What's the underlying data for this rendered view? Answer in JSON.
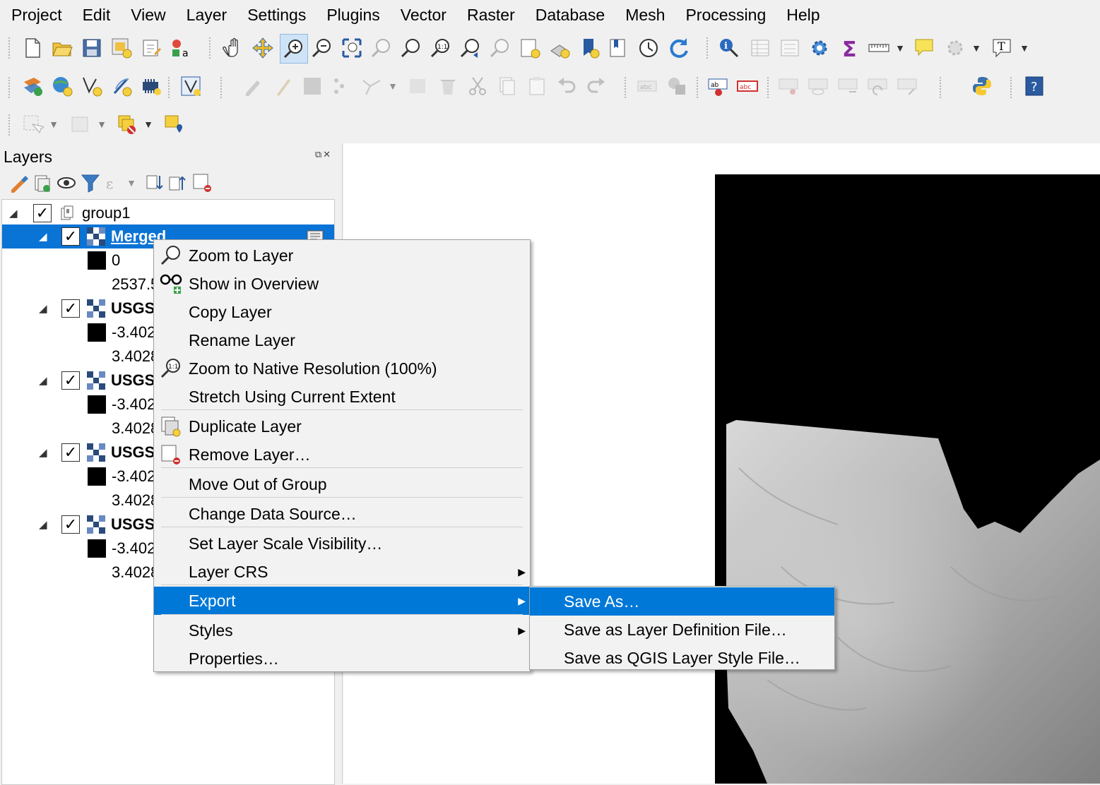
{
  "menubar": [
    "Project",
    "Edit",
    "View",
    "Layer",
    "Settings",
    "Plugins",
    "Vector",
    "Raster",
    "Database",
    "Mesh",
    "Processing",
    "Help"
  ],
  "layers_panel": {
    "title": "Layers",
    "tree": [
      {
        "label": "group1",
        "type": "group"
      },
      {
        "label": "Merged",
        "type": "layer",
        "selected": true
      },
      {
        "label": "0",
        "type": "legend-min"
      },
      {
        "label": "2537.5",
        "type": "legend-max"
      },
      {
        "label": "USGS",
        "type": "layer"
      },
      {
        "label": "-3.402",
        "type": "legend-min"
      },
      {
        "label": "3.4028",
        "type": "legend-max"
      },
      {
        "label": "USGS",
        "type": "layer"
      },
      {
        "label": "-3.402",
        "type": "legend-min"
      },
      {
        "label": "3.4028",
        "type": "legend-max"
      },
      {
        "label": "USGS",
        "type": "layer"
      },
      {
        "label": "-3.402",
        "type": "legend-min"
      },
      {
        "label": "3.4028",
        "type": "legend-max"
      },
      {
        "label": "USGS",
        "type": "layer"
      },
      {
        "label": "-3.402",
        "type": "legend-min"
      },
      {
        "label": "3.4028",
        "type": "legend-max"
      }
    ]
  },
  "context_menu": {
    "items": [
      {
        "label": "Zoom to Layer",
        "icon": "zoom-layer-icon"
      },
      {
        "label": "Show in Overview",
        "icon": "overview-icon"
      },
      {
        "label": "Copy Layer"
      },
      {
        "label": "Rename Layer"
      },
      {
        "label": "Zoom to Native Resolution (100%)",
        "icon": "zoom-native-icon"
      },
      {
        "label": "Stretch Using Current Extent"
      },
      {
        "label": "Duplicate Layer",
        "icon": "duplicate-layer-icon"
      },
      {
        "label": "Remove Layer…",
        "icon": "remove-layer-icon"
      },
      {
        "label": "Move Out of Group"
      },
      {
        "label": "Change Data Source…"
      },
      {
        "label": "Set Layer Scale Visibility…"
      },
      {
        "label": "Layer CRS",
        "submenu": true
      },
      {
        "label": "Export",
        "submenu": true,
        "highlighted": true
      },
      {
        "label": "Styles",
        "submenu": true
      },
      {
        "label": "Properties…"
      }
    ]
  },
  "export_submenu": {
    "items": [
      {
        "label": "Save As…",
        "highlighted": true
      },
      {
        "label": "Save as Layer Definition File…"
      },
      {
        "label": "Save as QGIS Layer Style File…"
      }
    ]
  },
  "colors": {
    "selection": "#0078d7",
    "tree_selection": "#0a73d6",
    "menu_bg": "#f2f2f2"
  }
}
